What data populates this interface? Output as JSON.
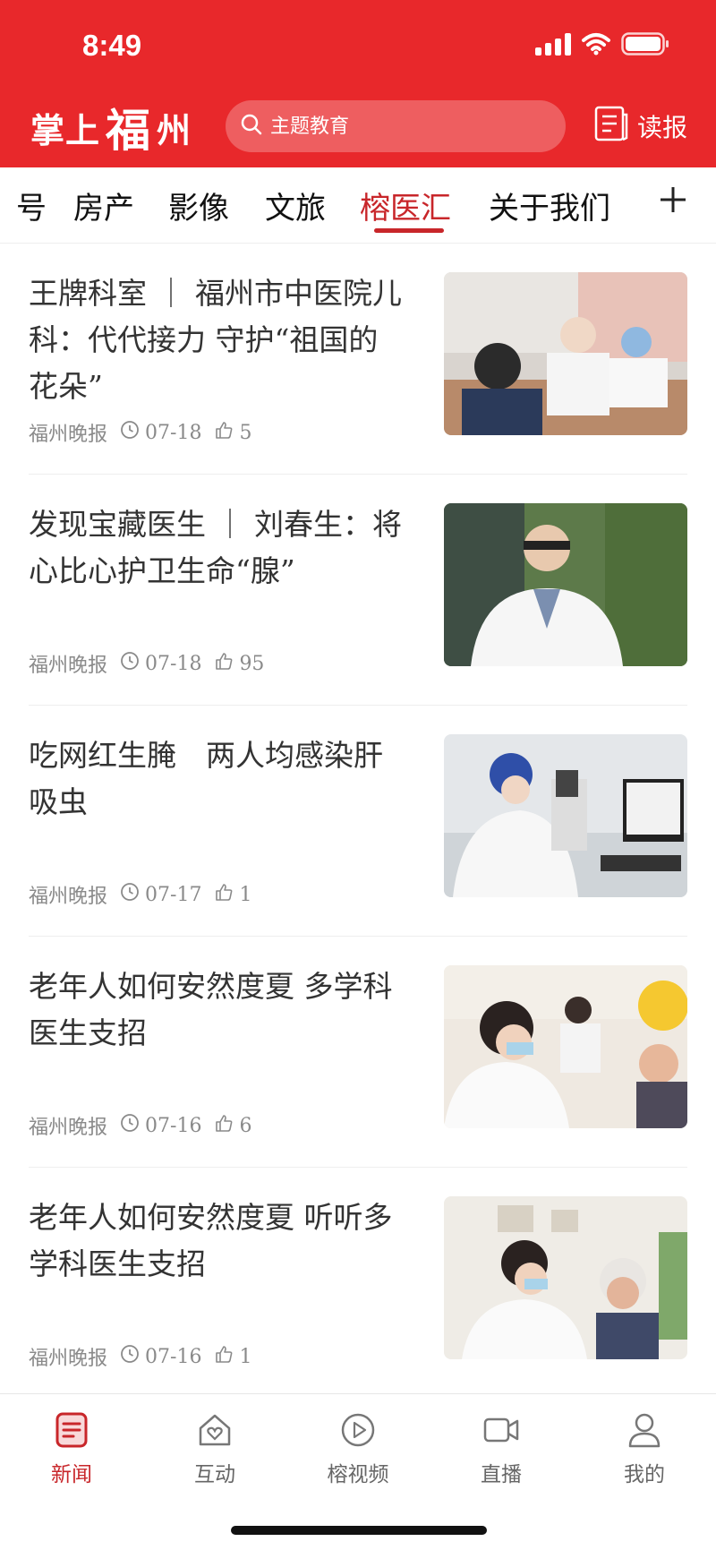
{
  "status_bar": {
    "time": "8:49"
  },
  "header": {
    "logo_text_left": "掌上",
    "logo_text_fu": "福",
    "logo_text_right": "州",
    "search_placeholder": "主题教育",
    "read_paper_label": "读报",
    "brand_color": "#e8282b"
  },
  "tabs": {
    "items": [
      {
        "label": "号"
      },
      {
        "label": "房产"
      },
      {
        "label": "影像"
      },
      {
        "label": "文旅"
      },
      {
        "label": "榕医汇"
      },
      {
        "label": "关于我们"
      }
    ],
    "active_index": 4,
    "active_color": "#c8262a"
  },
  "news": [
    {
      "title": "王牌科室 ｜ 福州市中医院儿科：代代接力 守护“祖国的花朵”",
      "source": "福州晚报",
      "date": "07-18",
      "likes": "5"
    },
    {
      "title": "发现宝藏医生 ｜ 刘春生：将心比心护卫生命“腺”",
      "source": "福州晚报",
      "date": "07-18",
      "likes": "95"
    },
    {
      "title": "吃网红生腌　两人均感染肝吸虫",
      "source": "福州晚报",
      "date": "07-17",
      "likes": "1"
    },
    {
      "title": "老年人如何安然度夏 多学科医生支招",
      "source": "福州晚报",
      "date": "07-16",
      "likes": "6"
    },
    {
      "title": "老年人如何安然度夏 听听多学科医生支招",
      "source": "福州晚报",
      "date": "07-16",
      "likes": "1"
    }
  ],
  "bottom_nav": {
    "items": [
      {
        "label": "新闻",
        "icon": "news-icon"
      },
      {
        "label": "互动",
        "icon": "interaction-icon"
      },
      {
        "label": "榕视频",
        "icon": "video-icon"
      },
      {
        "label": "直播",
        "icon": "live-camera-icon"
      },
      {
        "label": "我的",
        "icon": "profile-icon"
      }
    ],
    "active_index": 0
  }
}
